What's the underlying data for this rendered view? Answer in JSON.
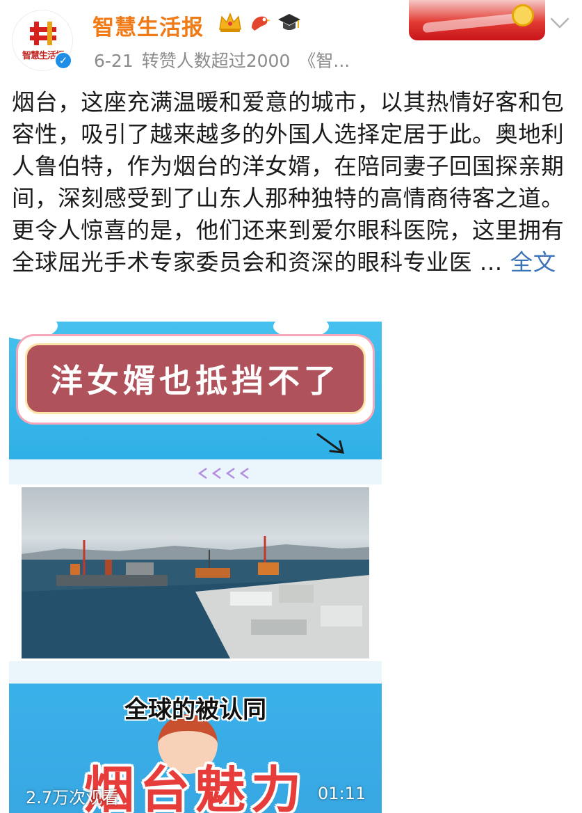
{
  "header": {
    "avatar_text": "智慧生活报",
    "account_name": "智慧生活报",
    "badges": [
      "crown-icon",
      "bird-icon",
      "graduation-cap-icon"
    ],
    "date": "6-21",
    "repost_note": "转赞人数超过2000",
    "source_snippet": "《智..."
  },
  "post": {
    "body": "烟台，这座充满温暖和爱意的城市，以其热情好客和包容性，吸引了越来越多的外国人选择定居于此。奥地利人鲁伯特，作为烟台的洋女婿，在陪同妻子回国探亲期间，深刻感受到了山东人那种独特的高情商待客之道。更令人惊喜的是，他们还来到爱尔眼科医院，这里拥有全球屈光手术专家委员会和资深的眼科专业医 ...",
    "more_label": "全文"
  },
  "video": {
    "title_card": "洋女婿也抵挡不了",
    "subtitle": "全球的被认同",
    "big_caption": "烟台魅力",
    "view_count": "2.7万次观看",
    "duration": "01:11"
  },
  "colors": {
    "account_name": "#f07a16",
    "link": "#3a73b8",
    "verified": "#1f8ee6",
    "title_card_fill": "#b0525c"
  }
}
